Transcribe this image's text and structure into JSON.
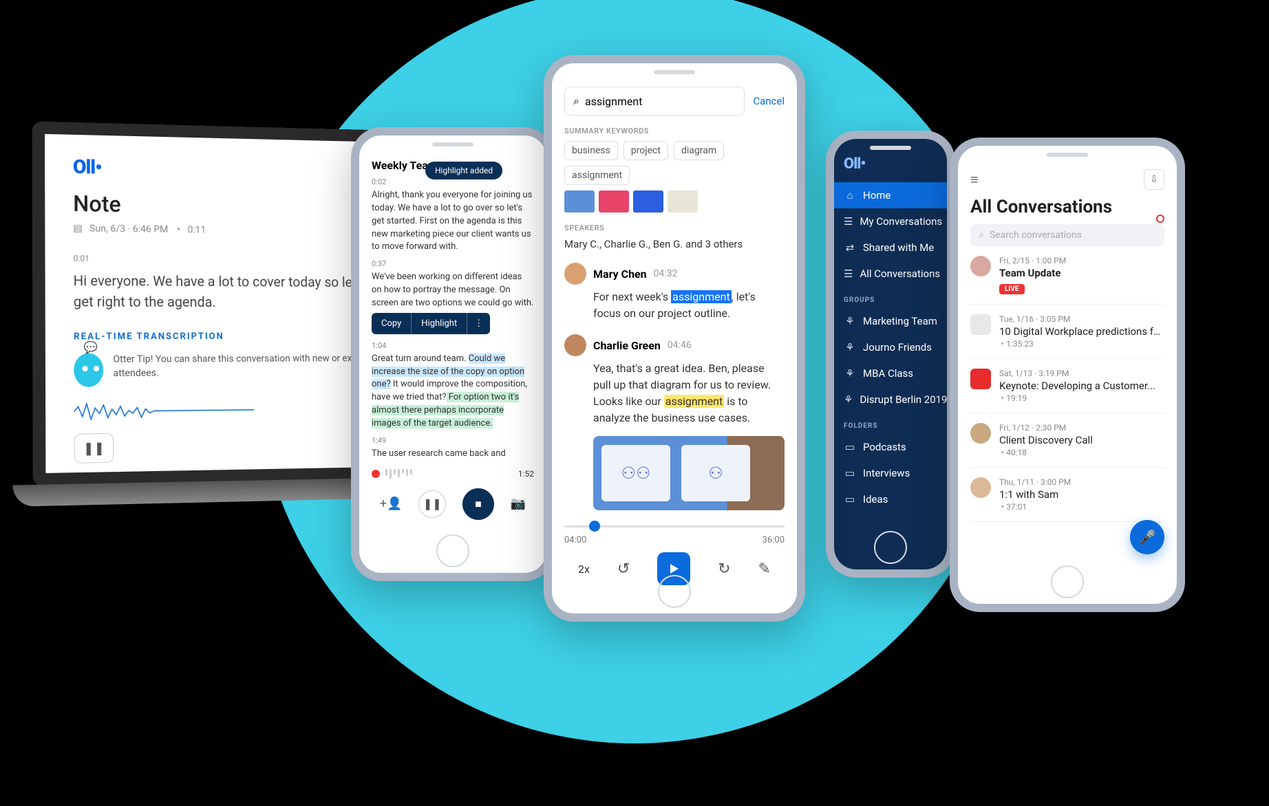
{
  "laptop": {
    "logo": "Oll•",
    "title": "Note",
    "date": "Sun, 6/3 · 6:46 PM",
    "duration": "0:11",
    "timestamp": "0:01",
    "body": "Hi everyone. We have a lot to cover today so let's get right to the agenda.",
    "rt_label": "REAL-TIME TRANSCRIPTION",
    "tip": "Otter Tip! You can share this conversation with new or existing attendees."
  },
  "p1": {
    "title": "Weekly Team Sync",
    "pill": "Highlight added",
    "segs": [
      {
        "ts": "0:02",
        "text": "Alright, thank you everyone for joining us today. We have a lot to go over so let's get started. First on the agenda is this new marketing piece our client wants us to move forward with."
      },
      {
        "ts": "0:37",
        "text": "We've been working on different ideas on how to portray the message. On screen are two options we could go with."
      },
      {
        "ts": "1:04",
        "text_a": "Great turn around team. ",
        "sel": "Could we increase the size of the copy on option one?",
        "text_b": " It would improve the composition, have we tried that?",
        "hl": " For option two it's almost there perhaps incorporate images of the target audience."
      },
      {
        "ts": "1:49",
        "text": "The user research came back and"
      }
    ],
    "popup": {
      "copy": "Copy",
      "highlight": "Highlight"
    },
    "rec_time": "1:52"
  },
  "p2": {
    "search_value": "assignment",
    "cancel": "Cancel",
    "kw_label": "SUMMARY KEYWORDS",
    "keywords": [
      "business",
      "project",
      "diagram",
      "assignment"
    ],
    "sp_label": "SPEAKERS",
    "speakers": "Mary C., Charlie G., Ben G. and 3 others",
    "msgs": [
      {
        "name": "Mary Chen",
        "time": "04:32",
        "body_a": "For next week's ",
        "hl": "assignment",
        "hl_type": "blue",
        "body_b": ", let's focus on our project outline."
      },
      {
        "name": "Charlie Green",
        "time": "04:46",
        "body_a": "Yea, that's a great idea. Ben, please pull up that diagram for us to review. Looks like our ",
        "hl": "assignment",
        "hl_type": "yellow",
        "body_b": " is to analyze the business use cases."
      }
    ],
    "time_start": "04:00",
    "time_end": "36:00",
    "speed": "2x"
  },
  "p3": {
    "logo": "Oll•",
    "nav": [
      {
        "icon": "⌂",
        "label": "Home",
        "active": true
      },
      {
        "icon": "☰",
        "label": "My Conversations"
      },
      {
        "icon": "⇄",
        "label": "Shared with Me"
      },
      {
        "icon": "☰",
        "label": "All Conversations"
      }
    ],
    "groups_label": "GROUPS",
    "groups": [
      {
        "icon": "⚘",
        "label": "Marketing Team"
      },
      {
        "icon": "⚘",
        "label": "Journo Friends"
      },
      {
        "icon": "⚘",
        "label": "MBA Class"
      },
      {
        "icon": "⚘",
        "label": "Disrupt Berlin 2019"
      }
    ],
    "folders_label": "FOLDERS",
    "folders": [
      {
        "icon": "▭",
        "label": "Podcasts"
      },
      {
        "icon": "▭",
        "label": "Interviews"
      },
      {
        "icon": "▭",
        "label": "Ideas"
      }
    ]
  },
  "p4": {
    "title": "All Conversations",
    "search_placeholder": "Search conversations",
    "items": [
      {
        "meta": "Fri, 2/15 · 1:00 PM",
        "title": "Team Update",
        "live": true,
        "live_label": "LIVE",
        "avatar": "#d9a8a0"
      },
      {
        "meta": "Tue, 1/16 · 3:05 PM",
        "title": "10 Digital Workplace predictions for...",
        "dur": "1:35:23",
        "avatar": "#e8e8e8",
        "square": true
      },
      {
        "meta": "Sat, 1/13 · 3:19 PM",
        "title": "Keynote: Developing a Customer...",
        "dur": "19:19",
        "avatar": "#e82c2c",
        "square": true
      },
      {
        "meta": "Fri, 1/12 · 2:30 PM",
        "title": "Client Discovery Call",
        "dur": "40:18",
        "avatar": "#c9a880"
      },
      {
        "meta": "Thu, 1/11 · 3:00 PM",
        "title": "1:1 with Sam",
        "dur": "37:01",
        "avatar": "#dcb896"
      }
    ]
  }
}
